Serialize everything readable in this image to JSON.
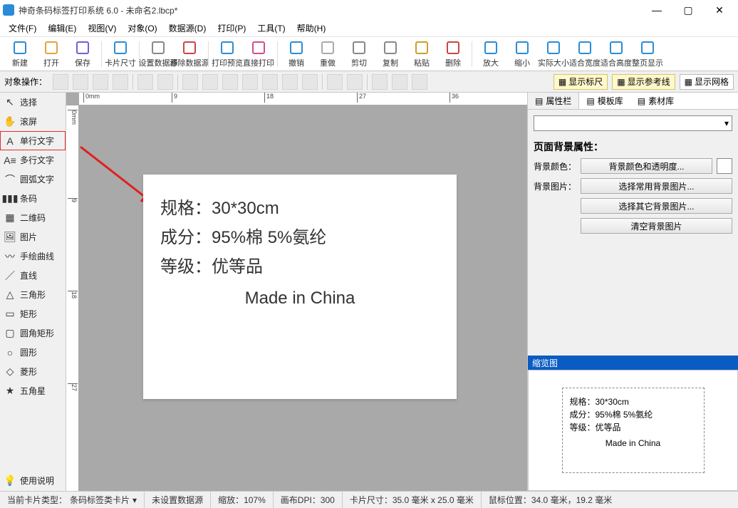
{
  "title": "神奇条码标签打印系统 6.0 - 未命名2.lbcp*",
  "window": {
    "min": "—",
    "max": "▢",
    "close": "✕"
  },
  "menus": [
    "文件(F)",
    "编辑(E)",
    "视图(V)",
    "对象(O)",
    "数据源(D)",
    "打印(P)",
    "工具(T)",
    "帮助(H)"
  ],
  "toolbar": [
    {
      "id": "new",
      "label": "新建"
    },
    {
      "id": "open",
      "label": "打开"
    },
    {
      "id": "save",
      "label": "保存"
    },
    {
      "sep": true
    },
    {
      "id": "cardsize",
      "label": "卡片尺寸"
    },
    {
      "sep": true
    },
    {
      "id": "setds",
      "label": "设置数据源"
    },
    {
      "id": "removeds",
      "label": "移除数据源"
    },
    {
      "sep": true
    },
    {
      "id": "preview",
      "label": "打印预览"
    },
    {
      "id": "print",
      "label": "直接打印"
    },
    {
      "sep": true
    },
    {
      "id": "undo",
      "label": "撤销"
    },
    {
      "id": "redo",
      "label": "重做"
    },
    {
      "id": "cut",
      "label": "剪切"
    },
    {
      "id": "copy",
      "label": "复制"
    },
    {
      "id": "paste",
      "label": "粘贴"
    },
    {
      "id": "delete",
      "label": "删除"
    },
    {
      "sep": true
    },
    {
      "id": "zoomin",
      "label": "放大"
    },
    {
      "id": "zoomout",
      "label": "缩小"
    },
    {
      "id": "actual",
      "label": "实际大小"
    },
    {
      "id": "fitw",
      "label": "适合宽度"
    },
    {
      "id": "fith",
      "label": "适合高度"
    },
    {
      "id": "fitpage",
      "label": "整页显示"
    }
  ],
  "optbar_label": "对象操作：",
  "toggles": [
    {
      "id": "ruler",
      "label": "显示标尺",
      "active": true
    },
    {
      "id": "guide",
      "label": "显示参考线",
      "active": true
    },
    {
      "id": "grid",
      "label": "显示网格",
      "active": false
    }
  ],
  "tools": [
    {
      "id": "select",
      "label": "选择",
      "glyph": "↖"
    },
    {
      "id": "pan",
      "label": "滚屏",
      "glyph": "✋"
    },
    {
      "id": "text1",
      "label": "单行文字",
      "glyph": "A",
      "hl": true
    },
    {
      "id": "textm",
      "label": "多行文字",
      "glyph": "A≡"
    },
    {
      "id": "arc",
      "label": "圆弧文字",
      "glyph": "⌒"
    },
    {
      "id": "barcode",
      "label": "条码",
      "glyph": "▮▮▮"
    },
    {
      "id": "qrcode",
      "label": "二维码",
      "glyph": "▦"
    },
    {
      "id": "image",
      "label": "图片",
      "glyph": "🖼"
    },
    {
      "id": "curve",
      "label": "手绘曲线",
      "glyph": "〰"
    },
    {
      "id": "line",
      "label": "直线",
      "glyph": "／"
    },
    {
      "id": "tri",
      "label": "三角形",
      "glyph": "△"
    },
    {
      "id": "rect",
      "label": "矩形",
      "glyph": "▭"
    },
    {
      "id": "rrect",
      "label": "圆角矩形",
      "glyph": "▢"
    },
    {
      "id": "ellipse",
      "label": "圆形",
      "glyph": "○"
    },
    {
      "id": "diamond",
      "label": "菱形",
      "glyph": "◇"
    },
    {
      "id": "star",
      "label": "五角星",
      "glyph": "★"
    }
  ],
  "help_tool": "使用说明",
  "hruler": [
    {
      "p": 6,
      "t": "0mm"
    },
    {
      "p": 130,
      "t": "9"
    },
    {
      "p": 260,
      "t": "18"
    },
    {
      "p": 390,
      "t": "27"
    },
    {
      "p": 520,
      "t": "36"
    }
  ],
  "vruler": [
    {
      "p": 6,
      "t": "0mm"
    },
    {
      "p": 130,
      "t": "9"
    },
    {
      "p": 260,
      "t": "18"
    },
    {
      "p": 390,
      "t": "27"
    }
  ],
  "label_lines": [
    "规格：30*30cm",
    "成分：95%棉 5%氨纶",
    "等级：优等品"
  ],
  "label_center": "Made in China",
  "rtabs": [
    {
      "id": "props",
      "label": "属性栏"
    },
    {
      "id": "tpl",
      "label": "模板库"
    },
    {
      "id": "assets",
      "label": "素材库"
    }
  ],
  "props": {
    "section": "页面背景属性：",
    "bgcolor_label": "背景颜色：",
    "bgcolor_btn": "背景颜色和透明度...",
    "bgimg_label": "背景图片：",
    "btn_common": "选择常用背景图片...",
    "btn_other": "选择其它背景图片...",
    "btn_clear": "清空背景图片"
  },
  "preview_title": "缩览图",
  "status": {
    "card_type_label": "当前卡片类型：",
    "card_type": "条码标签类卡片",
    "ds": "未设置数据源",
    "zoom": "缩放：107%",
    "dpi": "画布DPI：300",
    "size": "卡片尺寸：35.0 毫米 x 25.0 毫米",
    "mouse": "鼠标位置：34.0 毫米，19.2 毫米"
  }
}
